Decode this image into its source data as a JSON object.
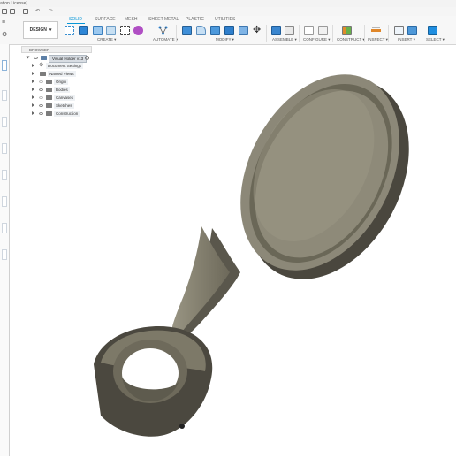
{
  "window": {
    "title": "ation License)"
  },
  "workspace": {
    "label": "DESIGN"
  },
  "tabs": [
    {
      "label": "SOLID",
      "active": true
    },
    {
      "label": "SURFACE"
    },
    {
      "label": "MESH"
    },
    {
      "label": "SHEET METAL"
    },
    {
      "label": "PLASTIC"
    },
    {
      "label": "UTILITIES"
    }
  ],
  "groups": {
    "create": "CREATE ▾",
    "automate": "AUTOMATE ▾",
    "modify": "MODIFY ▾",
    "assemble": "ASSEMBLE ▾",
    "configure": "CONFIGURE ▾",
    "construct": "CONSTRUCT ▾",
    "inspect": "INSPECT ▾",
    "insert": "INSERT ▾",
    "select": "SELECT ▾"
  },
  "browser": {
    "header": "BROWSER",
    "root": "Visual Holder v13",
    "items": [
      {
        "label": "Document Settings",
        "icon": "gear-icon"
      },
      {
        "label": "Named Views",
        "icon": "folder-icon"
      },
      {
        "label": "Origin",
        "icon": "folder-icon"
      },
      {
        "label": "Bodies",
        "icon": "folder-icon"
      },
      {
        "label": "Canvases",
        "icon": "folder-icon"
      },
      {
        "label": "Sketches",
        "icon": "folder-icon"
      },
      {
        "label": "Construction",
        "icon": "folder-icon"
      }
    ]
  },
  "colors": {
    "accent": "#0696d7",
    "model_body": "#858170",
    "model_dark": "#4f4c42",
    "model_light": "#a9a593"
  }
}
